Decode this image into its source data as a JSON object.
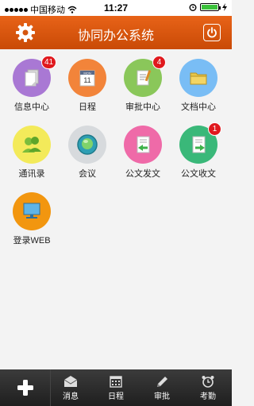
{
  "status_bar": {
    "carrier": "中国移动",
    "time": "11:27"
  },
  "header": {
    "title": "协同办公系统"
  },
  "apps": [
    {
      "label": "信息中心",
      "badge": "41",
      "color": "#a978d4"
    },
    {
      "label": "日程",
      "badge": "",
      "color": "#f2843a",
      "calendar_text": "11",
      "calendar_month": "MON"
    },
    {
      "label": "审批中心",
      "badge": "4",
      "color": "#8ac75a"
    },
    {
      "label": "文档中心",
      "badge": "",
      "color": "#79bdf5"
    },
    {
      "label": "通讯录",
      "badge": "",
      "color": "#f3ea5a"
    },
    {
      "label": "会议",
      "badge": "",
      "color": "#d7dadd"
    },
    {
      "label": "公文发文",
      "badge": "",
      "color": "#ef6aa8"
    },
    {
      "label": "公文收文",
      "badge": "1",
      "color": "#3ab879"
    },
    {
      "label": "登录WEB",
      "badge": "",
      "color": "#f2960f"
    }
  ],
  "tabbar": {
    "tabs": [
      {
        "label": "消息",
        "icon": "envelope-icon"
      },
      {
        "label": "日程",
        "icon": "calendar-icon"
      },
      {
        "label": "审批",
        "icon": "pen-icon"
      },
      {
        "label": "考勤",
        "icon": "alarm-clock-icon"
      }
    ]
  }
}
